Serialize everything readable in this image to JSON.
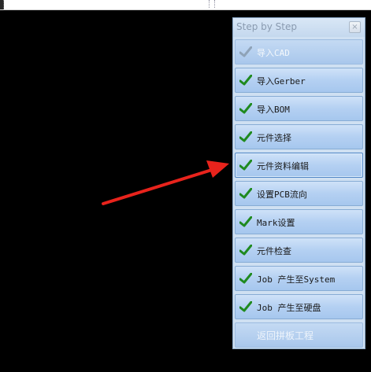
{
  "panel": {
    "title": "Step by Step",
    "close_glyph": "×",
    "steps": [
      {
        "label": "导入CAD",
        "checked": true,
        "enabled": false
      },
      {
        "label": "导入Gerber",
        "checked": true,
        "enabled": true
      },
      {
        "label": "导入BOM",
        "checked": true,
        "enabled": true
      },
      {
        "label": "元件选择",
        "checked": true,
        "enabled": true
      },
      {
        "label": "元件资料编辑",
        "checked": true,
        "enabled": true,
        "highlighted": true
      },
      {
        "label": "设置PCB流向",
        "checked": true,
        "enabled": true
      },
      {
        "label": "Mark设置",
        "checked": true,
        "enabled": true
      },
      {
        "label": "元件检查",
        "checked": true,
        "enabled": true
      },
      {
        "label": "Job 产生至System",
        "checked": true,
        "enabled": true
      },
      {
        "label": "Job 产生至硬盘",
        "checked": true,
        "enabled": true
      }
    ],
    "back_button_label": "返回拼板工程"
  },
  "colors": {
    "background": "#000000",
    "panel": "#cfe0f2",
    "check_green": "#1f8a1f",
    "check_disabled": "#8fa3b8",
    "arrow_red": "#e8231c"
  },
  "icons": {
    "check": "check-icon",
    "close": "close-icon",
    "annotation": "red-arrow-annotation"
  }
}
